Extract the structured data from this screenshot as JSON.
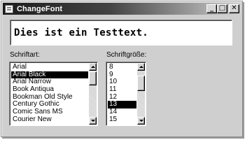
{
  "window": {
    "title": "ChangeFont",
    "controls": {
      "minimize": "_",
      "maximize": "□",
      "close": "✕"
    },
    "icon": "document-icon"
  },
  "preview": {
    "text": "Dies ist ein Testtext."
  },
  "font_list": {
    "label": "Schriftart:",
    "items": [
      "Arial",
      "Arial Black",
      "Arial Narrow",
      "Book Antiqua",
      "Bookman Old Style",
      "Century Gothic",
      "Comic Sans MS",
      "Courier New"
    ],
    "selected": "Arial Black"
  },
  "size_list": {
    "label": "Schriftgröße:",
    "items": [
      "8",
      "9",
      "10",
      "11",
      "12",
      "13",
      "14",
      "15"
    ],
    "selected": "13"
  },
  "colors": {
    "title_bar": "#1c1c1c",
    "selection": "#000000",
    "face": "#cfcfcf"
  }
}
